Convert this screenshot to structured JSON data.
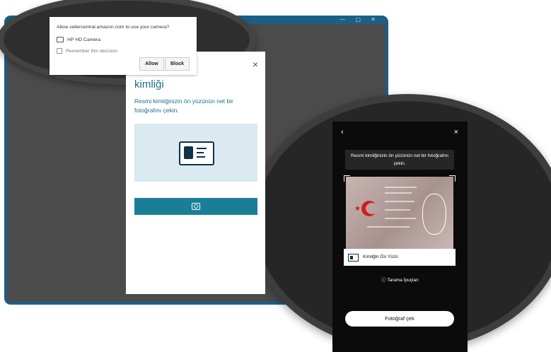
{
  "permission_prompt": {
    "title": "Allow sellercentral.amazon.com to use your camera?",
    "camera_name": "HP HD Camera",
    "remember_label": "Remember this decision",
    "allow_label": "Allow",
    "block_label": "Block"
  },
  "modal": {
    "heading": "kimliği",
    "description": "Resmi kimliğinizin ön yüzünün net bir fotoğrafını çekin.",
    "close_icon": "×"
  },
  "phone": {
    "back_icon": "‹",
    "close_icon": "×",
    "instruction": "Resmi kimliğinizin ön yüzünün net bir fotoğrafını çekin.",
    "card_label": "Kimliğin Ön Yüzü",
    "tips_label": "ⓘ Tarama İpuçları",
    "take_photo_label": "Fotoğraf çek"
  },
  "colors": {
    "browser_frame": "#1c5f86",
    "accent": "#1a7f96",
    "background_dark": "#4b4b4b"
  }
}
